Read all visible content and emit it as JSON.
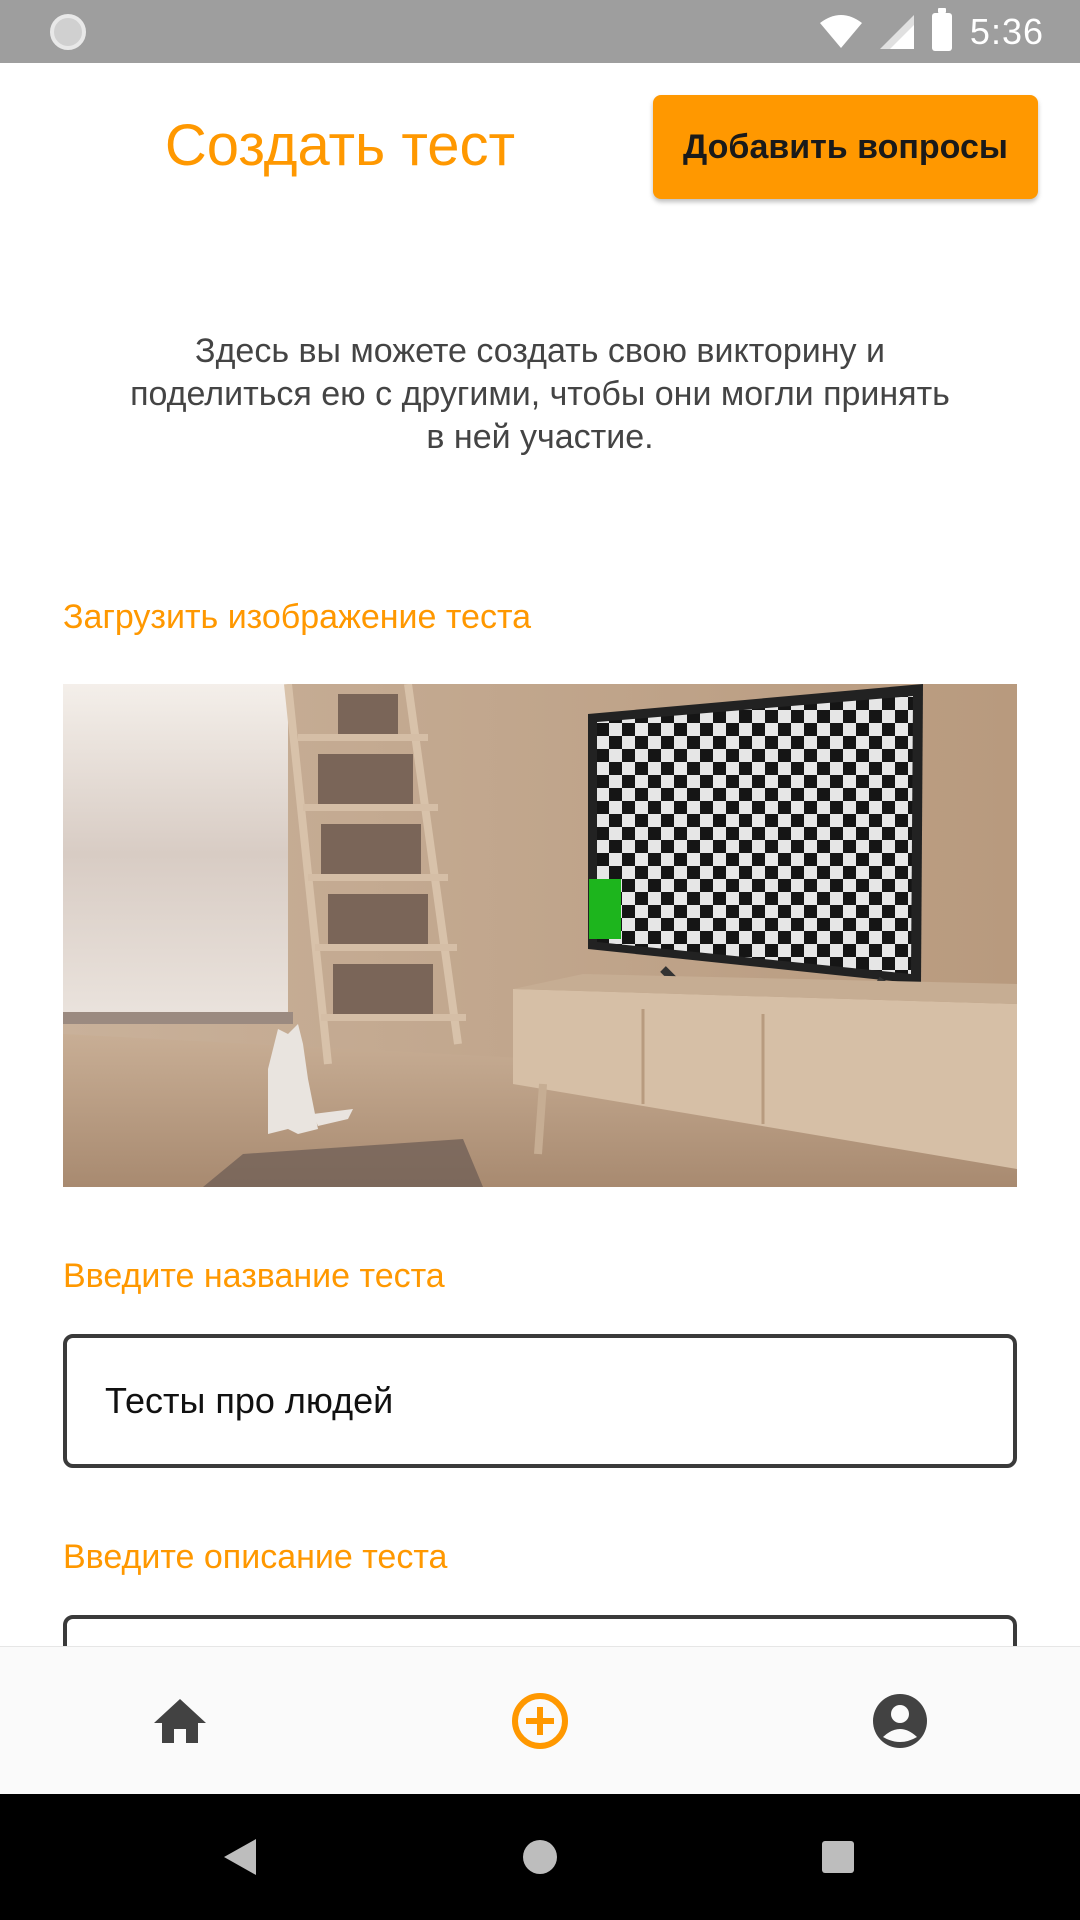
{
  "status_bar": {
    "time": "5:36",
    "icons": [
      "sync-icon",
      "wifi-icon",
      "signal-icon",
      "battery-icon"
    ]
  },
  "header": {
    "title": "Создать тест",
    "add_questions_label": "Добавить вопросы"
  },
  "intro": {
    "text": "Здесь вы можете создать свою викторину и поделиться ею с другими, чтобы они могли принять в ней участие."
  },
  "image_section": {
    "label": "Загрузить изображение теста"
  },
  "name_section": {
    "label": "Введите название теста",
    "value": "Тесты про людей"
  },
  "description_section": {
    "label": "Введите описание теста",
    "value": ""
  },
  "bottom_nav": {
    "items": [
      {
        "icon": "home-icon",
        "active": false
      },
      {
        "icon": "add-circle-icon",
        "active": true
      },
      {
        "icon": "account-circle-icon",
        "active": false
      }
    ]
  },
  "system_nav": {
    "icons": [
      "back-icon",
      "home-circle-icon",
      "recents-icon"
    ]
  },
  "colors": {
    "accent": "#ff9800",
    "status_bar": "#9e9e9e",
    "text_dark": "#333333",
    "icon_dark": "#424242"
  }
}
